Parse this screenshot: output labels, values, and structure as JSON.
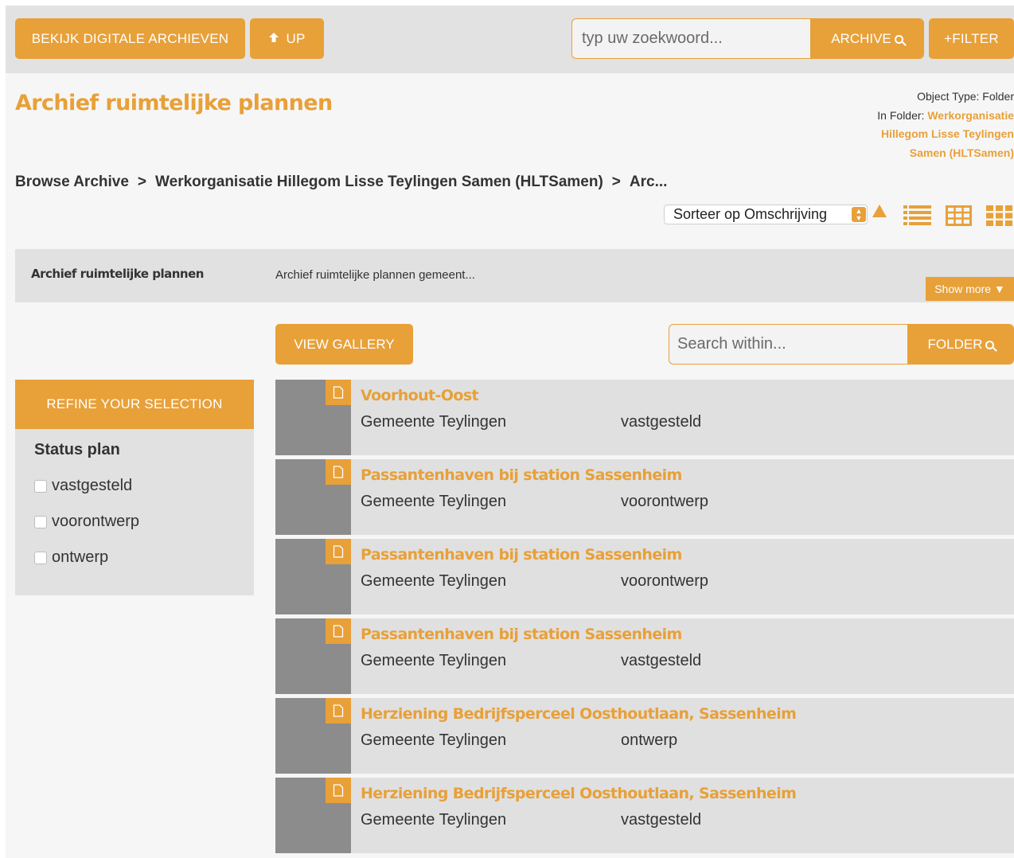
{
  "topbar": {
    "digital_archives": "BEKIJK DIGITALE ARCHIEVEN",
    "up": "UP",
    "search_placeholder": "typ uw zoekwoord...",
    "archive_search": "ARCHIVE",
    "filter": "+FILTER"
  },
  "page": {
    "title": "Archief ruimtelijke plannen",
    "object_type_label": "Object Type: Folder",
    "in_folder_label": "In Folder:",
    "in_folder_link": "Werkorganisatie Hillegom Lisse Teylingen Samen (HLTSamen)"
  },
  "breadcrumb": {
    "items": [
      "Browse Archive",
      "Werkorganisatie Hillegom Lisse Teylingen Samen (HLTSamen)",
      "Arc..."
    ],
    "separator": ">"
  },
  "sort": {
    "selected": "Sorteer op Omschrijving"
  },
  "description": {
    "title": "Archief ruimtelijke plannen",
    "text": "Archief ruimtelijke plannen gemeent...",
    "show_more": "Show more ▼"
  },
  "gallery": {
    "label": "VIEW GALLERY"
  },
  "folder_search": {
    "placeholder": "Search within...",
    "button": "FOLDER"
  },
  "refine": {
    "header": "REFINE YOUR SELECTION",
    "facet_title": "Status plan",
    "options": [
      "vastgesteld",
      "voorontwerp",
      "ontwerp"
    ]
  },
  "results": [
    {
      "title": "Voorhout-Oost",
      "org": "Gemeente Teylingen",
      "status": "vastgesteld"
    },
    {
      "title": "Passantenhaven bij station Sassenheim",
      "org": "Gemeente Teylingen",
      "status": "voorontwerp"
    },
    {
      "title": "Passantenhaven bij station Sassenheim",
      "org": "Gemeente Teylingen",
      "status": "voorontwerp"
    },
    {
      "title": "Passantenhaven bij station Sassenheim",
      "org": "Gemeente Teylingen",
      "status": "vastgesteld"
    },
    {
      "title": "Herziening Bedrijfsperceel Oosthoutlaan, Sassenheim",
      "org": "Gemeente Teylingen",
      "status": "ontwerp"
    },
    {
      "title": "Herziening Bedrijfsperceel Oosthoutlaan, Sassenheim",
      "org": "Gemeente Teylingen",
      "status": "vastgesteld"
    }
  ],
  "colors": {
    "accent": "#e8a038",
    "panel": "#e1e1e1",
    "thumb": "#8c8c8c",
    "text": "#333333"
  },
  "icons": [
    "arrow-up-icon",
    "search-icon",
    "sort-caret-icon",
    "sort-ascending-icon",
    "list-view-icon",
    "table-view-icon",
    "grid-view-icon",
    "file-icon"
  ]
}
